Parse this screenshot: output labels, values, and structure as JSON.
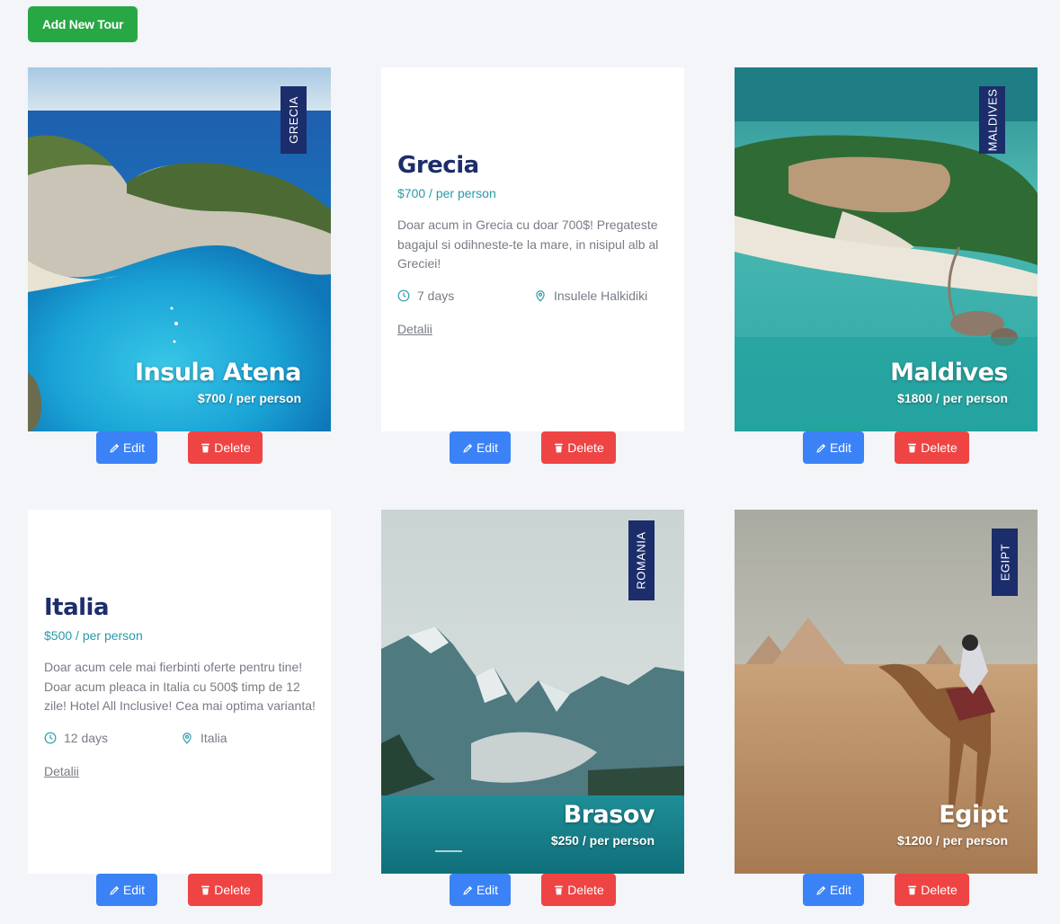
{
  "toolbar": {
    "add_label": "Add New Tour"
  },
  "colors": {
    "navy": "#1c2d6b",
    "teal": "#2a9aa8",
    "edit": "#3b82f6",
    "delete": "#ef4444",
    "add": "#28a745"
  },
  "actions": {
    "edit_label": "Edit",
    "delete_label": "Delete"
  },
  "tours": [
    {
      "kind": "image",
      "ribbon": "GRECIA",
      "title": "Insula Atena",
      "price": "$700 / per person"
    },
    {
      "kind": "text",
      "title": "Grecia",
      "price": "$700 / per person",
      "description": "Doar acum in Grecia cu doar 700$! Pregateste bagajul si odihneste-te la mare, in nisipul alb al Greciei!",
      "duration": "7 days",
      "location": "Insulele Halkidiki",
      "link": "Detalii"
    },
    {
      "kind": "image",
      "ribbon": "MALDIVES",
      "title": "Maldives",
      "price": "$1800 / per person"
    },
    {
      "kind": "text",
      "title": "Italia",
      "price": "$500 / per person",
      "description": "Doar acum cele mai fierbinti oferte pentru tine! Doar acum pleaca in Italia cu 500$ timp de 12 zile! Hotel All Inclusive! Cea mai optima varianta!",
      "duration": "12 days",
      "location": "Italia",
      "link": "Detalii"
    },
    {
      "kind": "image",
      "ribbon": "ROMANIA",
      "title": "Brasov",
      "price": "$250 / per person"
    },
    {
      "kind": "image",
      "ribbon": "EGIPT",
      "title": "Egipt",
      "price": "$1200 / per person"
    }
  ]
}
